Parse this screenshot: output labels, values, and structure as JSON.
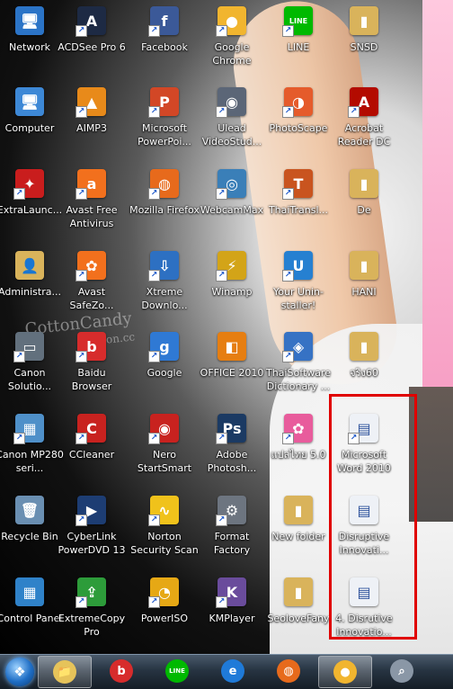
{
  "desktop": {
    "icons": [
      {
        "label": "Network",
        "glyph": "🖥",
        "bg": "#2b74c7",
        "shortcut": false
      },
      {
        "label": "ACDSee Pro 6",
        "glyph": "A",
        "bg": "#1d2a44",
        "shortcut": true
      },
      {
        "label": "Facebook",
        "glyph": "f",
        "bg": "#3b5998",
        "shortcut": true
      },
      {
        "label": "Google Chrome",
        "glyph": "●",
        "bg": "#f1b52f",
        "shortcut": true
      },
      {
        "label": "LINE",
        "glyph": "LINE",
        "bg": "#00b900",
        "shortcut": true
      },
      {
        "label": "SNSD",
        "glyph": "▮",
        "bg": "#d9b35b",
        "shortcut": false
      },
      {
        "label": "Computer",
        "glyph": "🖥",
        "bg": "#3d88d6",
        "shortcut": false
      },
      {
        "label": "AIMP3",
        "glyph": "▲",
        "bg": "#e88a1a",
        "shortcut": true
      },
      {
        "label": "Microsoft PowerPoi...",
        "glyph": "P",
        "bg": "#d24726",
        "shortcut": true
      },
      {
        "label": "Ulead VideoStud...",
        "glyph": "◉",
        "bg": "#5b6677",
        "shortcut": true
      },
      {
        "label": "PhotoScape",
        "glyph": "◑",
        "bg": "#e55b2b",
        "shortcut": true
      },
      {
        "label": "Acrobat Reader DC",
        "glyph": "A",
        "bg": "#b30b00",
        "shortcut": true
      },
      {
        "label": "ExtraLaunc...",
        "glyph": "✦",
        "bg": "#c91d1d",
        "shortcut": true
      },
      {
        "label": "Avast Free Antivirus",
        "glyph": "a",
        "bg": "#f2701d",
        "shortcut": true
      },
      {
        "label": "Mozilla Firefox",
        "glyph": "◍",
        "bg": "#e76a1c",
        "shortcut": true
      },
      {
        "label": "WebcamMax",
        "glyph": "◎",
        "bg": "#3a7fb8",
        "shortcut": true
      },
      {
        "label": "ThaiTransl...",
        "glyph": "T",
        "bg": "#c9541f",
        "shortcut": true
      },
      {
        "label": "De",
        "glyph": "▮",
        "bg": "#d9b35b",
        "shortcut": false
      },
      {
        "label": "Administra...",
        "glyph": "👤",
        "bg": "#d9b35b",
        "shortcut": false
      },
      {
        "label": "Avast SafeZo...",
        "glyph": "✿",
        "bg": "#f2701d",
        "shortcut": true
      },
      {
        "label": "Xtreme Downlo...",
        "glyph": "⇩",
        "bg": "#2d70c2",
        "shortcut": true
      },
      {
        "label": "Winamp",
        "glyph": "⚡",
        "bg": "#d3a418",
        "shortcut": true
      },
      {
        "label": "Your Unin-staller!",
        "glyph": "U",
        "bg": "#2680d1",
        "shortcut": true
      },
      {
        "label": "HANI",
        "glyph": "▮",
        "bg": "#d9b35b",
        "shortcut": false
      },
      {
        "label": "Canon Solutio...",
        "glyph": "▭",
        "bg": "#62707d",
        "shortcut": true
      },
      {
        "label": "Baidu Browser",
        "glyph": "b",
        "bg": "#d72c2c",
        "shortcut": true
      },
      {
        "label": "Google",
        "glyph": "g",
        "bg": "#2f79d4",
        "shortcut": true
      },
      {
        "label": "OFFICE 2010",
        "glyph": "◧",
        "bg": "#e67e11",
        "shortcut": false
      },
      {
        "label": "ThaiSoftware Dictionary ...",
        "glyph": "◈",
        "bg": "#3672c4",
        "shortcut": true
      },
      {
        "label": "จริง60",
        "glyph": "▮",
        "bg": "#d9b35b",
        "shortcut": false
      },
      {
        "label": "Canon MP280 seri...",
        "glyph": "▦",
        "bg": "#4f90c9",
        "shortcut": true
      },
      {
        "label": "CCleaner",
        "glyph": "C",
        "bg": "#c8221f",
        "shortcut": true
      },
      {
        "label": "Nero StartSmart",
        "glyph": "◉",
        "bg": "#c8221f",
        "shortcut": true
      },
      {
        "label": "Adobe Photosh...",
        "glyph": "Ps",
        "bg": "#1b3a63",
        "shortcut": true
      },
      {
        "label": "แปลไทย 5.0",
        "glyph": "✿",
        "bg": "#e85c9c",
        "shortcut": true
      },
      {
        "label": "Microsoft Word 2010",
        "glyph": "▤",
        "bg": "#eef1f6",
        "shortcut": true
      },
      {
        "label": "Recycle Bin",
        "glyph": "🗑",
        "bg": "#6a8fb2",
        "shortcut": false
      },
      {
        "label": "CyberLink PowerDVD 13",
        "glyph": "▶",
        "bg": "#1d3d73",
        "shortcut": true
      },
      {
        "label": "Norton Security Scan",
        "glyph": "∿",
        "bg": "#f0c21b",
        "shortcut": true
      },
      {
        "label": "Format Factory",
        "glyph": "⚙",
        "bg": "#6d7580",
        "shortcut": true
      },
      {
        "label": "New folder",
        "glyph": "▮",
        "bg": "#d9b35b",
        "shortcut": false
      },
      {
        "label": "Disruptive Innovati...",
        "glyph": "▤",
        "bg": "#eef1f6",
        "shortcut": false
      },
      {
        "label": "Control Panel",
        "glyph": "▦",
        "bg": "#2f82c9",
        "shortcut": false
      },
      {
        "label": "ExtremeCopy Pro",
        "glyph": "⇪",
        "bg": "#2d9c3a",
        "shortcut": true
      },
      {
        "label": "PowerISO",
        "glyph": "◔",
        "bg": "#e6a815",
        "shortcut": true
      },
      {
        "label": "KMPlayer",
        "glyph": "K",
        "bg": "#6a4c9c",
        "shortcut": true
      },
      {
        "label": "SeoloveFany",
        "glyph": "▮",
        "bg": "#d9b35b",
        "shortcut": false
      },
      {
        "label": "4. Disrutive Innovatio...",
        "glyph": "▤",
        "bg": "#eef1f6",
        "shortcut": false
      }
    ],
    "watermark": {
      "line1": "CottonCandy",
      "line2": "tegleon.cc"
    }
  },
  "taskbar": {
    "items": [
      {
        "name": "file-explorer",
        "glyph": "📁",
        "bg": "#e6c35a",
        "active": true
      },
      {
        "name": "baidu-browser",
        "glyph": "b",
        "bg": "#d72c2c",
        "active": false
      },
      {
        "name": "line",
        "glyph": "LINE",
        "bg": "#00b900",
        "active": false
      },
      {
        "name": "internet-explorer",
        "glyph": "e",
        "bg": "#1f7ad8",
        "active": false
      },
      {
        "name": "firefox",
        "glyph": "◍",
        "bg": "#e76a1c",
        "active": false
      },
      {
        "name": "chrome",
        "glyph": "●",
        "bg": "#f1b52f",
        "active": true
      },
      {
        "name": "search",
        "glyph": "⌕",
        "bg": "#8a97a6",
        "active": false
      }
    ]
  },
  "colors": {
    "selection": "#e00000"
  }
}
